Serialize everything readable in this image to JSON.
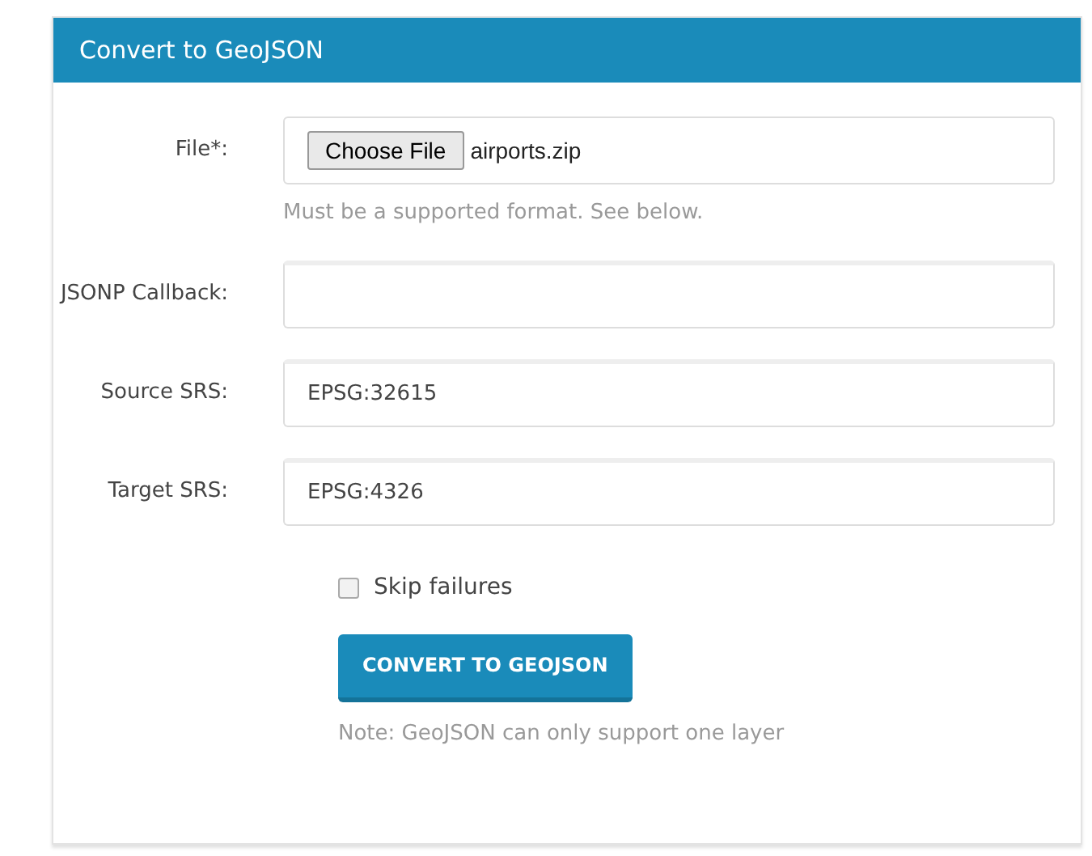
{
  "panel": {
    "title": "Convert to GeoJSON"
  },
  "fields": [
    {
      "kind": "file",
      "label": "File*:",
      "button": "Choose File",
      "value": "airports.zip",
      "help": "Must be a supported format. See below."
    },
    {
      "kind": "text",
      "label": "JSONP Callback:"
    },
    {
      "kind": "text",
      "label": "Source SRS:",
      "value": "EPSG:32615"
    },
    {
      "kind": "text",
      "label": "Target SRS:",
      "value": "EPSG:4326"
    }
  ],
  "checkbox": {
    "label": "Skip failures",
    "checked": false
  },
  "submit": {
    "label": "CONVERT TO GEOJSON"
  },
  "note": "Note: GeoJSON can only support one layer"
}
